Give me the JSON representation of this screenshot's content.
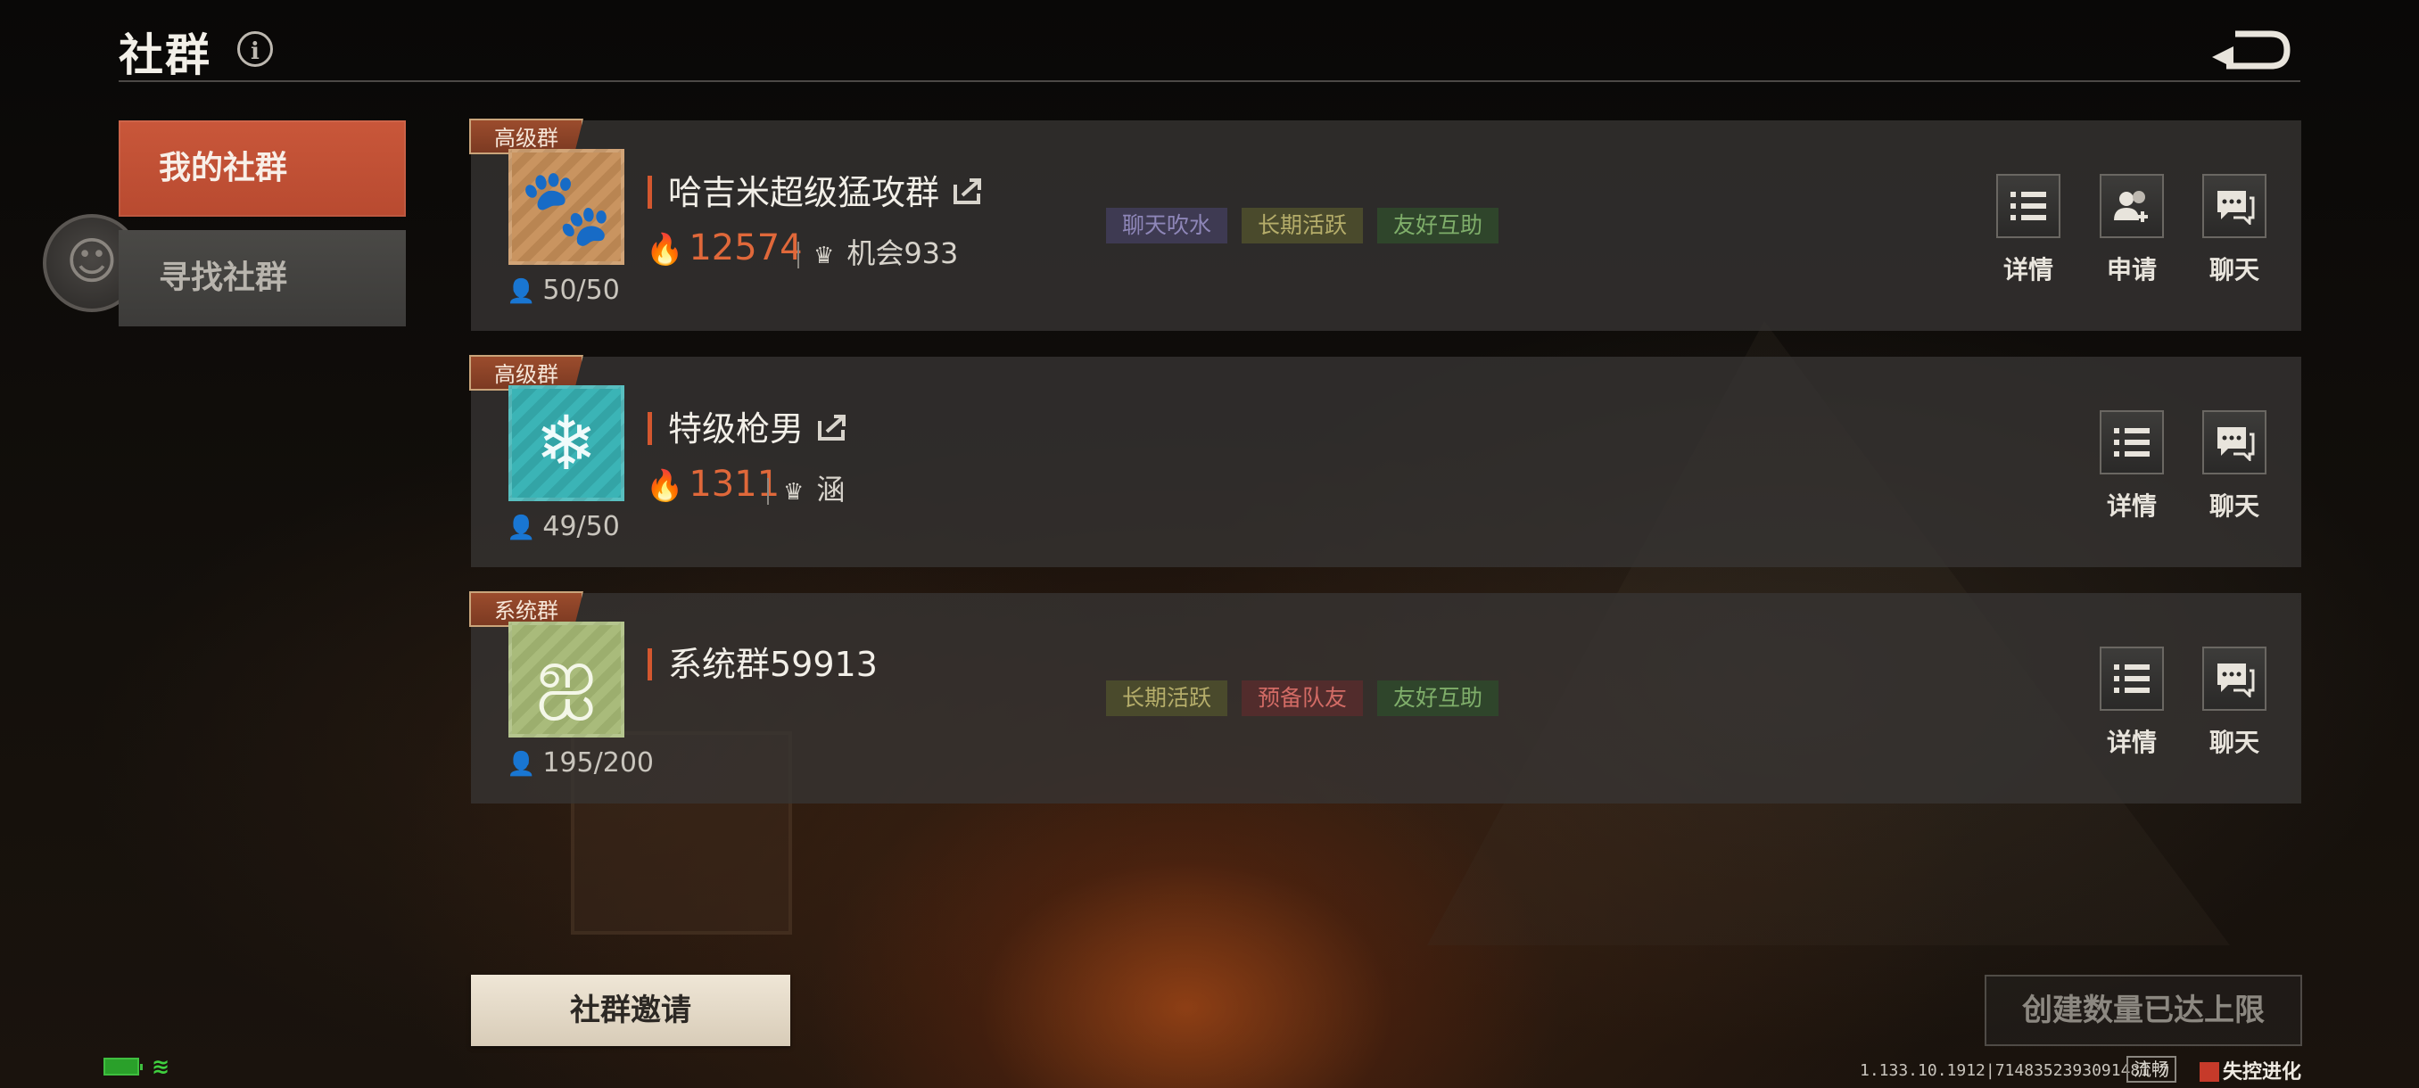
{
  "header": {
    "title": "社群",
    "info_icon": "info-icon",
    "back_icon": "back-arrow-icon"
  },
  "sidebar": {
    "tabs": [
      {
        "label": "我的社群",
        "selected": true
      },
      {
        "label": "寻找社群",
        "selected": false
      }
    ]
  },
  "groups": [
    {
      "badge": "高级群",
      "icon": "paw-icon",
      "name": "哈吉米超级猛攻群",
      "members": "50/50",
      "heat": "12574",
      "owner": "机会933",
      "tags": [
        "聊天吹水",
        "长期活跃",
        "友好互助"
      ],
      "actions": [
        "详情",
        "申请",
        "聊天"
      ]
    },
    {
      "badge": "高级群",
      "icon": "snowflake-icon",
      "name": "特级枪男",
      "members": "49/50",
      "heat": "1311",
      "owner": "涵",
      "tags": [],
      "actions": [
        "详情",
        "聊天"
      ]
    },
    {
      "badge": "系统群",
      "icon": "system-group-icon",
      "name": "系统群59913",
      "members": "195/200",
      "tags": [
        "长期活跃",
        "预备队友",
        "友好互助"
      ],
      "actions": [
        "详情",
        "聊天"
      ]
    }
  ],
  "footer": {
    "invite_label": "社群邀请",
    "limit_label": "创建数量已达上限",
    "version": "1.133.10.1912|7148352393091481 7",
    "network": "流畅",
    "logo_text": "失控进化"
  },
  "colors": {
    "accent": "#d4572f",
    "heat": "#e0683a",
    "tab_active": "#c9573a"
  }
}
